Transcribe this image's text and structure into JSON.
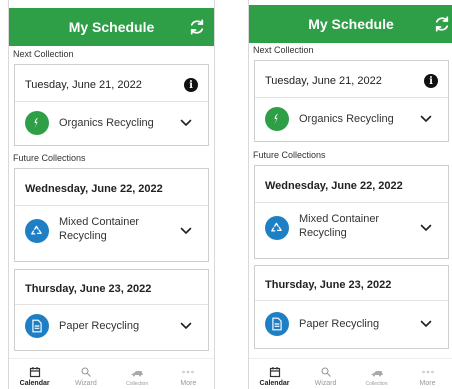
{
  "colors": {
    "header": "#2e9e47",
    "organics": "#2e9e47",
    "recycling": "#1f7fc4"
  },
  "screens": [
    {
      "header": {
        "title": "My Schedule",
        "refresh_icon": "refresh-icon"
      },
      "next_label": "Next Collection",
      "next_card": {
        "date": "Tuesday, June 21, 2022",
        "type": "Organics Recycling"
      },
      "future_label": "Future Collections",
      "future_cards": [
        {
          "date": "Wednesday, June 22, 2022",
          "type_line1": "Mixed Container",
          "type_line2": "Recycling"
        },
        {
          "date": "Thursday, June 23, 2022",
          "type": "Paper Recycling"
        }
      ],
      "nav": [
        "Calendar",
        "Wizard",
        "Collection",
        "More"
      ]
    },
    {
      "header": {
        "title": "My Schedule",
        "refresh_icon": "refresh-icon"
      },
      "next_label": "Next Collection",
      "next_card": {
        "date": "Tuesday, June 21, 2022",
        "type": "Organics Recycling"
      },
      "future_label": "Future Collections",
      "future_cards": [
        {
          "date": "Wednesday, June 22, 2022",
          "type_line1": "Mixed Container",
          "type_line2": "Recycling"
        },
        {
          "date": "Thursday, June 23, 2022",
          "type": "Paper Recycling"
        }
      ],
      "nav": [
        "Calendar",
        "Wizard",
        "Collection",
        "More"
      ]
    }
  ]
}
